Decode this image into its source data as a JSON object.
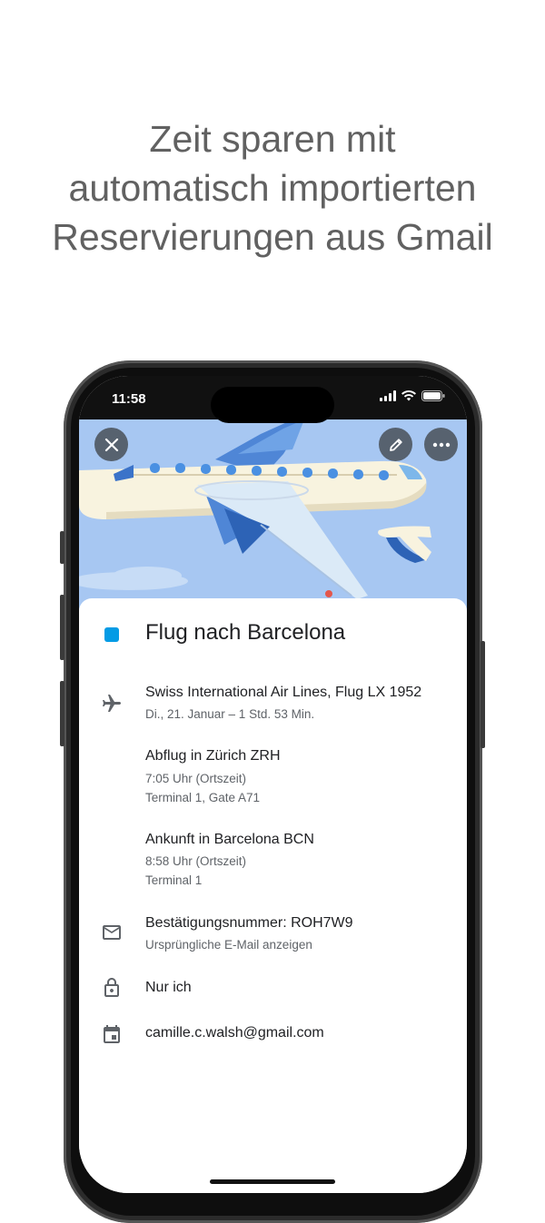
{
  "headline": {
    "line1": "Zeit sparen mit",
    "line2": "automatisch importierten",
    "line3": "Reservierungen aus Gmail"
  },
  "status_bar": {
    "time": "11:58",
    "icons": [
      "cellular-signal-icon",
      "wifi-icon",
      "battery-icon"
    ]
  },
  "header_actions": {
    "close_icon": "close-icon",
    "edit_icon": "pencil-icon",
    "more_icon": "more-horizontal-icon"
  },
  "event": {
    "color": "#039be5",
    "title": "Flug nach Barcelona",
    "flight": {
      "icon": "airplane-icon",
      "airline": "Swiss International Air Lines, Flug LX 1952",
      "date_duration": "Di., 21. Januar – 1 Std. 53 Min."
    },
    "departure": {
      "title": "Abflug in Zürich ZRH",
      "time": "7:05 Uhr (Ortszeit)",
      "terminal": "Terminal 1, Gate A71"
    },
    "arrival": {
      "title": "Ankunft in Barcelona BCN",
      "time": "8:58 Uhr (Ortszeit)",
      "terminal": "Terminal 1"
    },
    "confirmation": {
      "icon": "mail-icon",
      "label": "Bestätigungsnummer: ROH7W9",
      "link": "Ursprüngliche E-Mail anzeigen"
    },
    "visibility": {
      "icon": "lock-icon",
      "label": "Nur ich"
    },
    "calendar": {
      "icon": "calendar-icon",
      "account": "camille.c.walsh@gmail.com"
    }
  },
  "colors": {
    "headline_text": "#616161",
    "hero_background": "#a7c7f2",
    "accent": "#039be5"
  }
}
